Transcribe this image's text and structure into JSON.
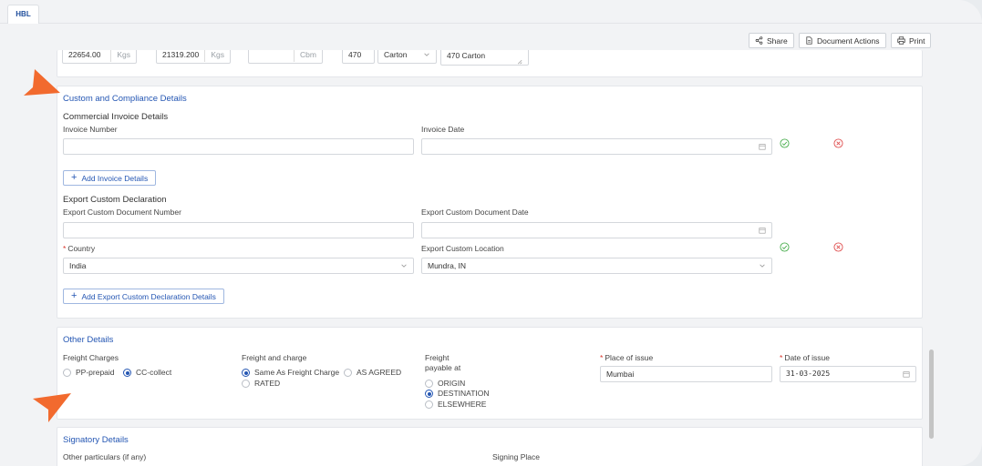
{
  "tabs": [
    {
      "label": "HBL"
    }
  ],
  "toolbar": {
    "share_label": "Share",
    "document_actions_label": "Document Actions",
    "print_label": "Print"
  },
  "top_row": {
    "gross_weight": "22654.00",
    "gross_unit": "Kgs",
    "net_weight": "21319.200",
    "net_unit": "Kgs",
    "volume_unit": "Cbm",
    "packages": "470",
    "package_type": "Carton",
    "package_description": "470 Carton"
  },
  "custom": {
    "title": "Custom and Compliance Details",
    "commercial_invoice_title": "Commercial Invoice Details",
    "invoice_number_label": "Invoice Number",
    "invoice_date_label": "Invoice Date",
    "add_invoice_label": "Add Invoice Details",
    "export_title": "Export Custom Declaration",
    "export_doc_number_label": "Export Custom Document Number",
    "export_doc_date_label": "Export Custom Document Date",
    "country_label": "Country",
    "country_value": "India",
    "export_location_label": "Export Custom Location",
    "export_location_value": "Mundra, IN",
    "add_export_label": "Add Export Custom Declaration Details"
  },
  "other": {
    "title": "Other Details",
    "freight_charges_label": "Freight Charges",
    "freight_charges_options": [
      {
        "label": "PP-prepaid",
        "selected": false
      },
      {
        "label": "CC-collect",
        "selected": true
      }
    ],
    "freight_and_charge_label": "Freight and charge",
    "freight_and_charge_options": [
      {
        "label": "Same As Freight Charge",
        "selected": true
      },
      {
        "label": "AS AGREED",
        "selected": false
      },
      {
        "label": "RATED",
        "selected": false
      }
    ],
    "freight_payable_label_1": "Freight",
    "freight_payable_label_2": "payable at",
    "freight_payable_options": [
      {
        "label": "ORIGIN",
        "selected": false
      },
      {
        "label": "DESTINATION",
        "selected": true
      },
      {
        "label": "ELSEWHERE",
        "selected": false
      }
    ],
    "place_of_issue_label": "Place of issue",
    "place_of_issue_value": "Mumbai",
    "date_of_issue_label": "Date of issue",
    "date_of_issue_value": "31-03-2025"
  },
  "signatory": {
    "title": "Signatory Details",
    "other_particulars_label": "Other particulars (if any)",
    "signing_place_label": "Signing Place"
  },
  "colors": {
    "accent": "#2456b3",
    "arrow": "#f26a2e",
    "success": "#4caf50",
    "danger": "#e05252"
  }
}
